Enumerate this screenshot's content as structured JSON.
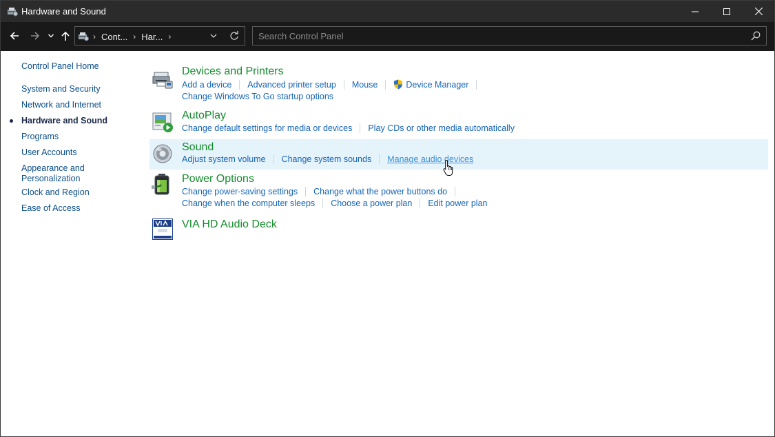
{
  "window": {
    "title": "Hardware and Sound"
  },
  "address": {
    "crumbs": [
      "Cont...",
      "Har..."
    ]
  },
  "search": {
    "placeholder": "Search Control Panel"
  },
  "sidebar": {
    "home": "Control Panel Home",
    "items": [
      {
        "label": "System and Security",
        "current": false
      },
      {
        "label": "Network and Internet",
        "current": false
      },
      {
        "label": "Hardware and Sound",
        "current": true
      },
      {
        "label": "Programs",
        "current": false
      },
      {
        "label": "User Accounts",
        "current": false
      },
      {
        "label": "Appearance and Personalization",
        "current": false
      },
      {
        "label": "Clock and Region",
        "current": false
      },
      {
        "label": "Ease of Access",
        "current": false
      }
    ]
  },
  "categories": {
    "devices": {
      "title": "Devices and Printers",
      "links": [
        "Add a device",
        "Advanced printer setup",
        "Mouse",
        "Device Manager",
        "Change Windows To Go startup options"
      ]
    },
    "autoplay": {
      "title": "AutoPlay",
      "links": [
        "Change default settings for media or devices",
        "Play CDs or other media automatically"
      ]
    },
    "sound": {
      "title": "Sound",
      "links": [
        "Adjust system volume",
        "Change system sounds",
        "Manage audio devices"
      ]
    },
    "power": {
      "title": "Power Options",
      "links": [
        "Change power-saving settings",
        "Change what the power buttons do",
        "Change when the computer sleeps",
        "Choose a power plan",
        "Edit power plan"
      ]
    },
    "via": {
      "title": "VIA HD Audio Deck",
      "logo_text": "VIA Vinyl HD Audio"
    }
  },
  "colors": {
    "category_title": "#148c2c",
    "link": "#1565b8",
    "hover_bg": "#e5f3fb",
    "titlebar": "#2b2b2b",
    "navbar": "#191919"
  }
}
